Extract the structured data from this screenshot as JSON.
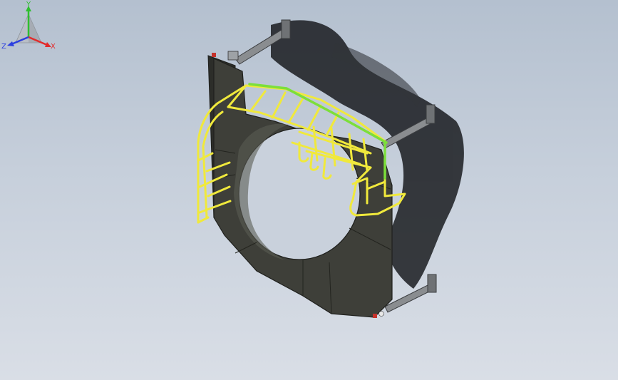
{
  "viewport": {
    "background_top": "#b4c0cf",
    "background_bottom": "#d9dee6"
  },
  "model": {
    "frame_color": "#3e3f39",
    "frame_edge_color": "#1f201d",
    "shadow_color": "#1a1c20",
    "rail_color": "#f0e93c",
    "rail_highlight_color": "#7cdf3a",
    "bracket_color": "#8a8d90"
  },
  "triad": {
    "x_label": "X",
    "y_label": "Y",
    "z_label": "Z",
    "x_color": "#e22b2b",
    "y_color": "#2fbf2f",
    "z_color": "#2b3fe0"
  }
}
